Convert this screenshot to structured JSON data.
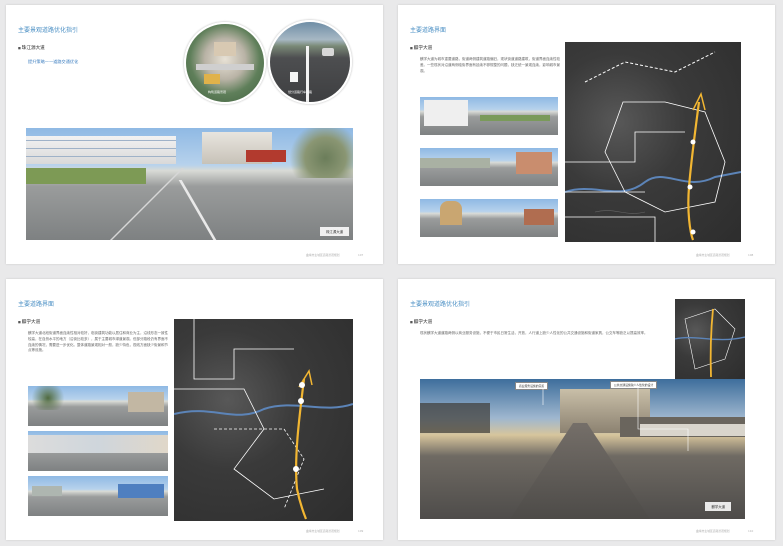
{
  "pages": [
    {
      "title": "主要景观道路优化指引",
      "section": "珠江源大道",
      "subtitle": "提升策略——道路交通优化",
      "circle_left_caption": "构筑道路景观",
      "circle_right_caption": "划分道路行车道路",
      "photo_caption": "珠江源大道",
      "footer": "曲靖市主城区道路景观规划",
      "page_no": "107"
    },
    {
      "title": "主要道路界面",
      "section": "麒学大道",
      "paragraph": "麒学大道为城市重要道路，街道两侧建筑道路偏旧，现状街道道路建筑，街道界面连续性较差。一些现状对沿道两侧临街界面有延续不够规整的问题，缺乏统一景观连续，影响城市景观。",
      "footer": "曲靖市主城区道路景观规划",
      "page_no": "108"
    },
    {
      "title": "主要道路界面",
      "section": "麒学大道",
      "paragraph": "麒学大道北段街道界面连续性相对较好，临街建筑功能以居住和商业为主，沿线形态一致性较高，在自然水平的地方（沿街比较多），属于主要城市绿道景观。但部分路段仍有界面不连续的情况，需要进一步优化。整体道路景观相对一般，缺少特色，视线方面缺少街景和节点等设施。",
      "footer": "曲靖市主城区道路景观规划",
      "page_no": "109"
    },
    {
      "title": "主要景观道路优化指引",
      "section": "麒学大道",
      "paragraph": "现状麒学大道道路两侧以商业服务设施，不便于市民日常生活，开放，人行道上缺少人性化的公共交通设施和街道家具，公交车等缺乏以提高效率。",
      "tag_left": "商业服务设施的完善",
      "tag_right": "公共交通设施缺少人性化的设计",
      "photo_caption": "麒学大道",
      "footer": "曲靖市主城区道路景观规划",
      "page_no": "110"
    }
  ],
  "colors": {
    "title_blue": "#4a8fc4",
    "route_yellow": "#f2b632",
    "page_bg": "#e9e9ea"
  }
}
